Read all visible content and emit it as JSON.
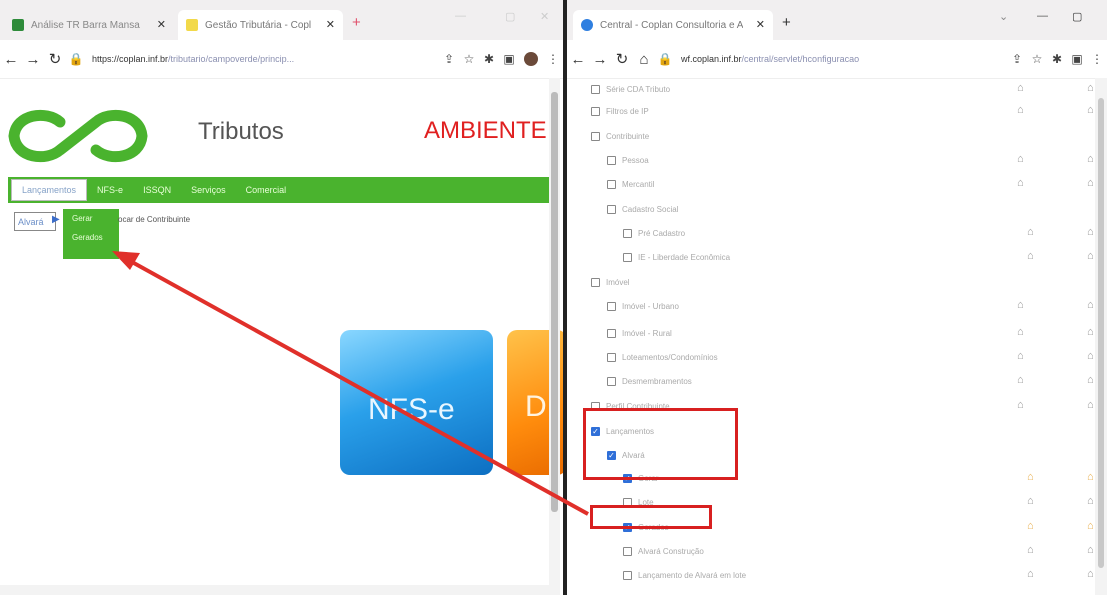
{
  "left_window": {
    "tabs": [
      {
        "label": "Análise TR Barra Mansa",
        "close": "✕"
      },
      {
        "label": "Gestão Tributária - Copl",
        "close": "✕"
      }
    ],
    "new_tab": "+",
    "url_host": "https://coplan.inf.br",
    "url_path": "/tributario/campoverde/princip...",
    "site": {
      "title": "Tributos",
      "env": "AMBIENTE",
      "menu": [
        "Lançamentos",
        "NFS-e",
        "ISSQN",
        "Serviços",
        "Comercial"
      ],
      "submenu_parent": "Alvará",
      "submenu": [
        "Gerar",
        "Gerados"
      ],
      "submenu_text": "ocar de Contribuinte",
      "tiles": [
        "NFS-e",
        "D"
      ]
    },
    "colors": {
      "brand_green": "#4ab32e",
      "env_red": "#e02020"
    }
  },
  "right_window": {
    "tab": {
      "label": "Central - Coplan Consultoria e A",
      "close": "✕"
    },
    "new_tab": "+",
    "url_host": "wf.coplan.inf.br",
    "url_path": "/central/servlet/hconfiguracao",
    "tree": [
      {
        "label": "Série CDA Tributo",
        "checked": false
      },
      {
        "label": "Filtros de IP",
        "checked": false
      },
      {
        "label": "Contribuinte",
        "checked": false
      },
      {
        "label": "Pessoa",
        "checked": false
      },
      {
        "label": "Mercantil",
        "checked": false
      },
      {
        "label": "Cadastro Social",
        "checked": false
      },
      {
        "label": "Pré Cadastro",
        "checked": false
      },
      {
        "label": "IE - Liberdade Econômica",
        "checked": false
      },
      {
        "label": "Imóvel",
        "checked": false
      },
      {
        "label": "Imóvel - Urbano",
        "checked": false
      },
      {
        "label": "Imóvel - Rural",
        "checked": false
      },
      {
        "label": "Loteamentos/Condomínios",
        "checked": false
      },
      {
        "label": "Desmembramentos",
        "checked": false
      },
      {
        "label": "Perfil Contribuinte",
        "checked": false
      },
      {
        "label": "Lançamentos",
        "checked": true
      },
      {
        "label": "Alvará",
        "checked": true
      },
      {
        "label": "Gerar",
        "checked": true
      },
      {
        "label": "Lote",
        "checked": false
      },
      {
        "label": "Gerados",
        "checked": true
      },
      {
        "label": "Alvará Construção",
        "checked": false
      },
      {
        "label": "Lançamento de Alvará em lote",
        "checked": false
      }
    ],
    "colors": {
      "highlight_red": "#d82020",
      "check_blue": "#2f6fd8"
    }
  }
}
